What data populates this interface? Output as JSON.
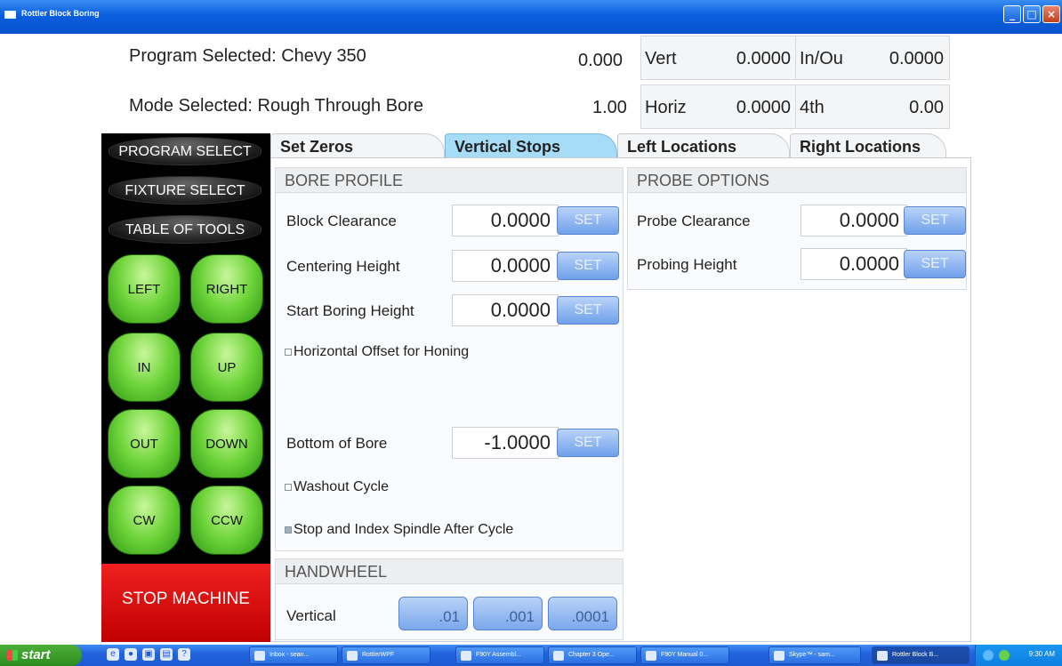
{
  "window": {
    "title": "Rottler Block Boring",
    "controls": {
      "minimize": "_",
      "maximize": "□",
      "close": "×"
    }
  },
  "status": {
    "program_label": "Program Selected: Chevy 350",
    "mode_label": "Mode Selected: Rough Through Bore",
    "value1": "0.000",
    "value2": "1.00",
    "axes": [
      {
        "label": "Vert",
        "value": "0.0000"
      },
      {
        "label": "In/Ou",
        "value": "0.0000"
      },
      {
        "label": "Horiz",
        "value": "0.0000"
      },
      {
        "label": "4th",
        "value": "0.00"
      }
    ]
  },
  "menu": {
    "program_select": "PROGRAM SELECT",
    "fixture_select": "FIXTURE SELECT",
    "table_of_tools": "TABLE OF TOOLS"
  },
  "jog": {
    "left": "LEFT",
    "right": "RIGHT",
    "in": "IN",
    "up": "UP",
    "out": "OUT",
    "down": "DOWN",
    "cw": "CW",
    "ccw": "CCW"
  },
  "stop_machine": "STOP MACHINE",
  "tabs": [
    {
      "label": "Set Zeros",
      "active": false
    },
    {
      "label": "Vertical Stops",
      "active": true
    },
    {
      "label": "Left Locations",
      "active": false
    },
    {
      "label": "Right Locations",
      "active": false
    }
  ],
  "bore_profile": {
    "title": "BORE PROFILE",
    "set_label": "SET",
    "rows": [
      {
        "label": "Block Clearance",
        "value": "0.0000"
      },
      {
        "label": "Centering Height",
        "value": "0.0000"
      },
      {
        "label": "Start Boring Height",
        "value": "0.0000"
      }
    ],
    "horizontal_offset": "Horizontal Offset for Honing",
    "bottom_of_bore": {
      "label": "Bottom of Bore",
      "value": "-1.0000"
    },
    "washout": "Washout Cycle",
    "stop_index": "Stop and Index Spindle After Cycle"
  },
  "probe_options": {
    "title": "PROBE OPTIONS",
    "rows": [
      {
        "label": "Probe Clearance",
        "value": "0.0000"
      },
      {
        "label": "Probing Height",
        "value": "0.0000"
      }
    ]
  },
  "handwheel": {
    "title": "HANDWHEEL",
    "axis_label": "Vertical",
    "increments": [
      ".01",
      ".001",
      ".0001"
    ]
  },
  "taskbar": {
    "start": "start",
    "tasks": [
      "Inbox - sean...",
      "RottlerWPF",
      "F90Y Assembl...",
      "Chapter 3 Ope...",
      "F90Y Manual 0...",
      "Skype™ - sam...",
      "Rottler Block B..."
    ],
    "clock": "9:30 AM"
  }
}
